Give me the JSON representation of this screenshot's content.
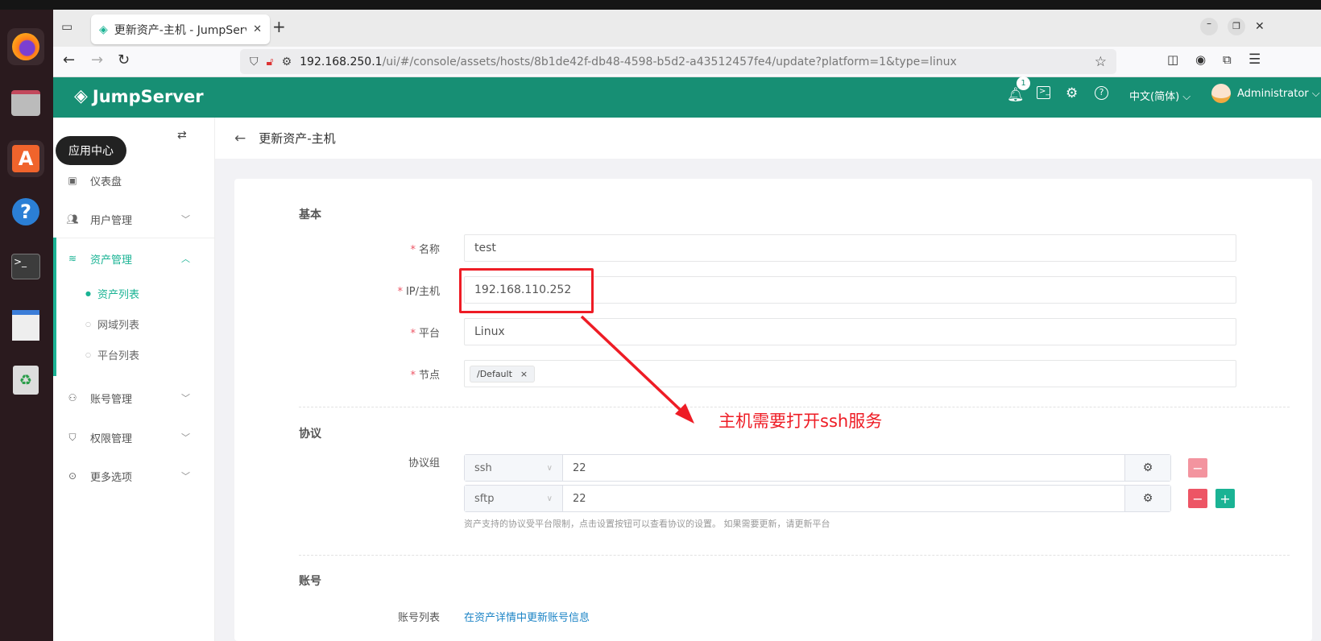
{
  "browser": {
    "tab_title": "更新资产-主机 - JumpServer",
    "url_host": "192.168.250.1",
    "url_path": "/ui/#/console/assets/hosts/8b1de42f-db48-4598-b5d2-a43512457fe4/update?platform=1&type=linux"
  },
  "dock": {
    "tooltip": "应用中心"
  },
  "header": {
    "logo": "JumpServer",
    "notification_count": "1",
    "language": "中文(简体)",
    "user": "Administrator"
  },
  "sidebar": {
    "items": [
      {
        "label": "仪表盘",
        "icon": "dashboard-icon"
      },
      {
        "label": "用户管理",
        "icon": "users-icon"
      },
      {
        "label": "资产管理",
        "icon": "layers-icon"
      },
      {
        "label": "账号管理",
        "icon": "accounts-icon"
      },
      {
        "label": "权限管理",
        "icon": "shield-icon"
      },
      {
        "label": "更多选项",
        "icon": "more-icon"
      }
    ],
    "subitems": [
      "资产列表",
      "网域列表",
      "平台列表"
    ]
  },
  "page": {
    "title": "更新资产-主机"
  },
  "form": {
    "basic_section": "基本",
    "name_label": "名称",
    "name_value": "test",
    "ip_label": "IP/主机",
    "ip_value": "192.168.110.252",
    "platform_label": "平台",
    "platform_value": "Linux",
    "node_label": "节点",
    "node_tag": "/Default",
    "protocol_section": "协议",
    "protocol_group_label": "协议组",
    "protocols": [
      {
        "name": "ssh",
        "port": "22"
      },
      {
        "name": "sftp",
        "port": "22"
      }
    ],
    "protocol_help": "资产支持的协议受平台限制，点击设置按钮可以查看协议的设置。 如果需要更新，请更新平台",
    "account_section": "账号",
    "account_list_label": "账号列表",
    "account_list_link": "在资产详情中更新账号信息"
  },
  "annotation": {
    "text": "主机需要打开ssh服务",
    "color": "#ee1c25"
  },
  "colors": {
    "brand": "#178f74",
    "accent": "#1ab394",
    "danger": "#ed5565"
  }
}
